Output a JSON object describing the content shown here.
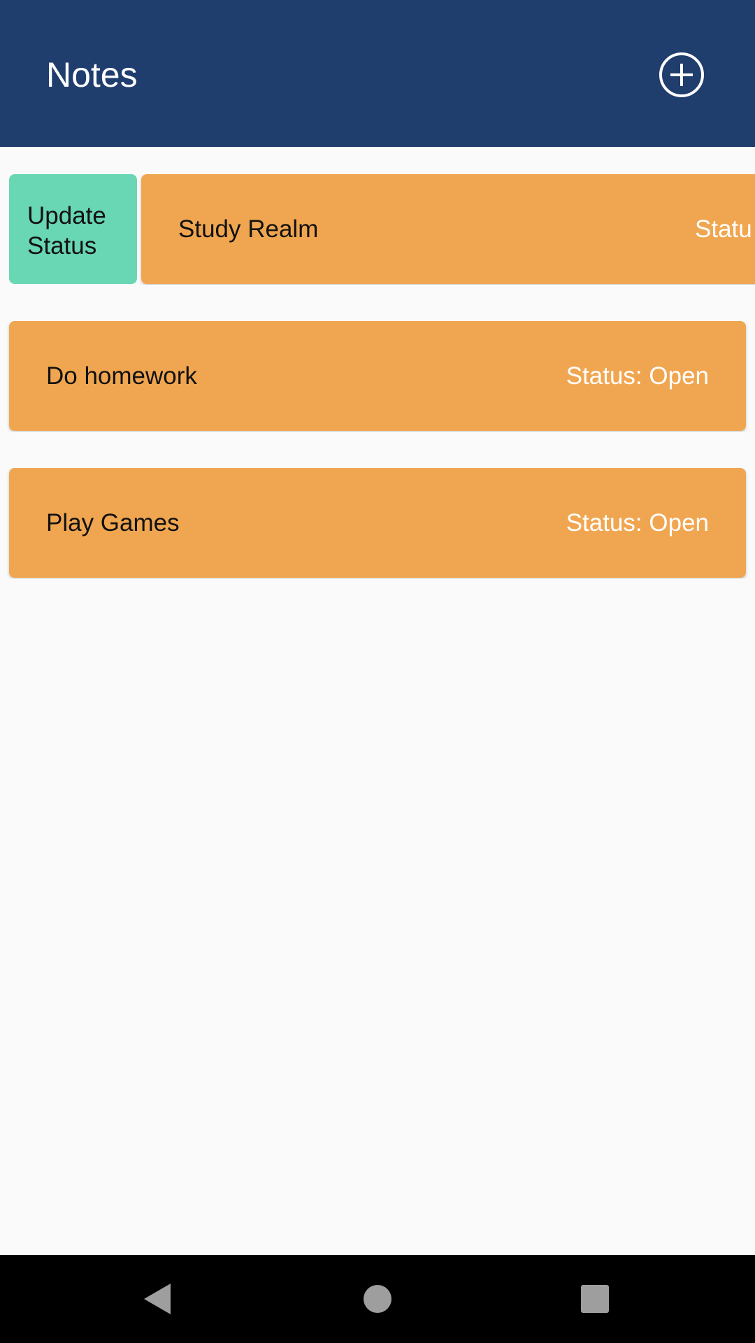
{
  "app_bar": {
    "title": "Notes",
    "add_icon": "add-circle-icon",
    "background": "#1f3d6d"
  },
  "notes": [
    {
      "title": "Study Realm",
      "status": "Status: Open",
      "status_visible": "Statu",
      "swipe_action": {
        "line1": "Update",
        "line2": "Status",
        "color": "#69d6b4"
      }
    },
    {
      "title": "Do homework",
      "status": "Status: Open"
    },
    {
      "title": "Play Games",
      "status": "Status: Open"
    }
  ],
  "card_color": "#f0a650",
  "nav": {
    "back_icon": "back-triangle-icon",
    "home_icon": "home-circle-icon",
    "recents_icon": "recents-square-icon"
  }
}
